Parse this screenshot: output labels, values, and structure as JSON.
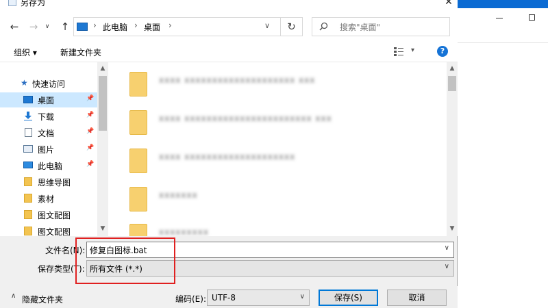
{
  "dialog": {
    "title": "另存为",
    "close_glyph": "✕"
  },
  "nav": {
    "back_glyph": "←",
    "forward_glyph": "→",
    "up_glyph": "↑",
    "dropdown_glyph": "∨",
    "refresh_glyph": "↻",
    "breadcrumb": [
      "此电脑",
      "桌面"
    ],
    "chevron": "›",
    "search_placeholder": "搜索\"桌面\""
  },
  "toolbar": {
    "organize_label": "组织 ▾",
    "new_folder_label": "新建文件夹",
    "view_drop": "▾",
    "help_label": "?"
  },
  "sidebar": {
    "quick_access_label": "快速访问",
    "star_glyph": "★",
    "pin_glyph": "📌",
    "items": [
      {
        "label": "桌面",
        "icon": "desktop-icon",
        "pinned": true,
        "selected": true
      },
      {
        "label": "下载",
        "icon": "download-icon",
        "pinned": true,
        "selected": false
      },
      {
        "label": "文档",
        "icon": "document-icon",
        "pinned": true,
        "selected": false
      },
      {
        "label": "图片",
        "icon": "picture-icon",
        "pinned": true,
        "selected": false
      },
      {
        "label": "此电脑",
        "icon": "computer-icon",
        "pinned": true,
        "selected": false
      },
      {
        "label": "思维导图",
        "icon": "folder-icon",
        "pinned": false,
        "selected": false
      },
      {
        "label": "素材",
        "icon": "folder-icon",
        "pinned": false,
        "selected": false
      },
      {
        "label": "图文配图",
        "icon": "folder-icon",
        "pinned": false,
        "selected": false
      },
      {
        "label": "图文配图",
        "icon": "folder-icon",
        "pinned": false,
        "selected": false
      }
    ],
    "scroll_up": "▲",
    "scroll_down": "▼"
  },
  "files": {
    "items": [
      {
        "name": "xxxx xxxxxxxxxxxxxxxxxxxx xxx",
        "icon": "folder-icon"
      },
      {
        "name": "xxxx xxxxxxxxxxxxxxxxxxxxxxx xxx",
        "icon": "folder-icon"
      },
      {
        "name": "xxxx xxxxxxxxxxxxxxxxxxxx",
        "icon": "folder-icon"
      },
      {
        "name": "xxxxxxx",
        "icon": "folder-icon"
      },
      {
        "name": "xxxxxxxxx",
        "icon": "folder-icon"
      }
    ],
    "scroll_up": "▲",
    "scroll_down": "▼"
  },
  "form": {
    "filename_label": "文件名(N):",
    "filename_value": "修复白图标.bat",
    "filetype_label": "保存类型(T):",
    "filetype_value": "所有文件 (*.*)",
    "drop_glyph": "∨"
  },
  "bottom": {
    "hide_folders_label": "隐藏文件夹",
    "hide_glyph": "∧",
    "encoding_label": "编码(E):",
    "encoding_value": "UTF-8",
    "save_label": "保存(S)",
    "cancel_label": "取消"
  },
  "colors": {
    "selected_bg": "#cce8ff",
    "accent": "#0078d7",
    "highlight": "#e02020"
  }
}
